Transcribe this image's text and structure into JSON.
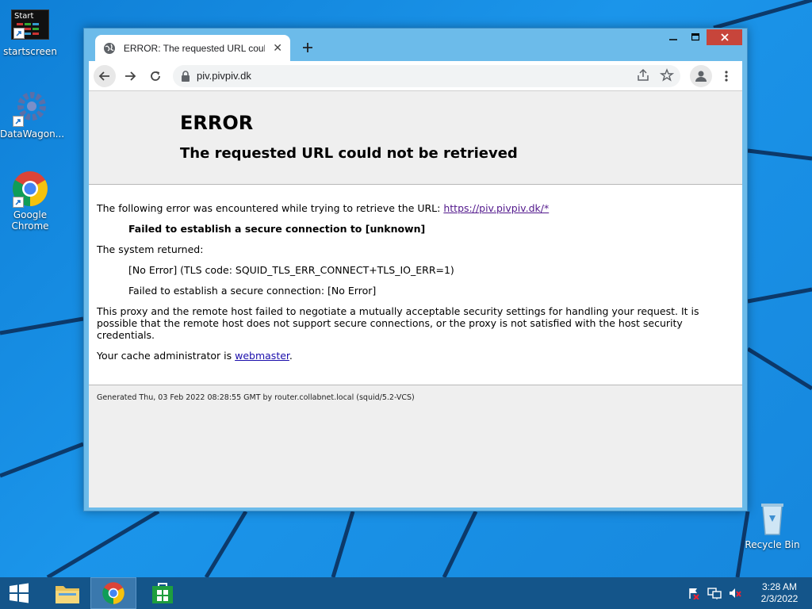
{
  "desktop": {
    "icons": [
      {
        "label": "startscreen",
        "thumb_text": "Start"
      },
      {
        "label": "DataWagon..."
      },
      {
        "label": "Google Chrome"
      },
      {
        "label": "Recycle Bin"
      }
    ]
  },
  "browser": {
    "tab_title": "ERROR: The requested URL could not be retrieved",
    "new_tab_label": "+",
    "url": "piv.pivpiv.dk"
  },
  "page": {
    "heading": "ERROR",
    "subheading": "The requested URL could not be retrieved",
    "intro": "The following error was encountered while trying to retrieve the URL: ",
    "intro_link": "https://piv.pivpiv.dk/*",
    "error_line": "Failed to establish a secure connection to [unknown]",
    "system_returned": "The system returned:",
    "system_code": "[No Error] (TLS code: SQUID_TLS_ERR_CONNECT+TLS_IO_ERR=1)",
    "system_detail": "Failed to establish a secure connection: [No Error]",
    "explanation": "This proxy and the remote host failed to negotiate a mutually acceptable security settings for handling your request. It is possible that the remote host does not support secure connections, or the proxy is not satisfied with the host security credentials.",
    "admin_text": "Your cache administrator is ",
    "admin_link": "webmaster",
    "admin_end": ".",
    "footer": "Generated Thu, 03 Feb 2022 08:28:55 GMT by router.collabnet.local (squid/5.2-VCS)"
  },
  "taskbar": {
    "time": "3:28 AM",
    "date": "2/3/2022"
  },
  "colors": {
    "desktop": "#1687dd",
    "taskbar": "#14558a",
    "close_button": "#c7453b",
    "window_frame": "#6cbbea"
  }
}
